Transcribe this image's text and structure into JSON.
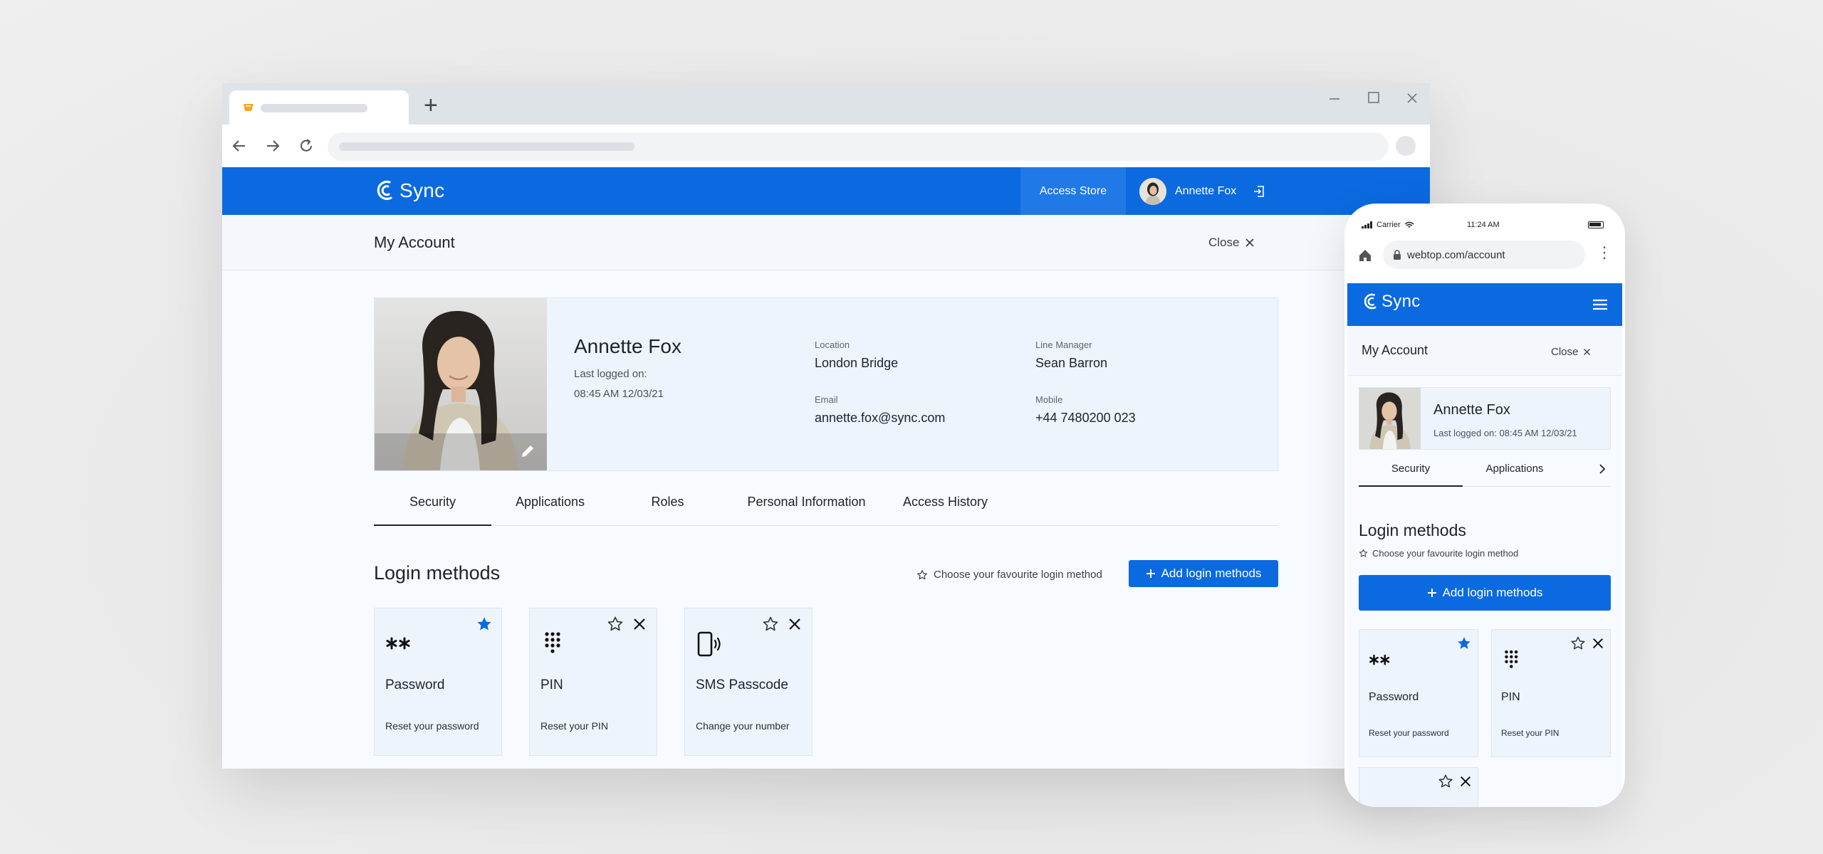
{
  "colors": {
    "brand": "#0b6ae0",
    "brand_hover": "#2079e6",
    "star_active": "#0b6ae0"
  },
  "desktop": {
    "header": {
      "logo_text": "Sync",
      "access_store_label": "Access Store",
      "user_name": "Annette Fox"
    },
    "subbar": {
      "title": "My Account",
      "close_label": "Close"
    },
    "profile": {
      "name": "Annette Fox",
      "last_logged_label": "Last logged on:",
      "last_logged_value": "08:45 AM 12/03/21",
      "location_label": "Location",
      "location_value": "London Bridge",
      "manager_label": "Line Manager",
      "manager_value": "Sean Barron",
      "email_label": "Email",
      "email_value": "annette.fox@sync.com",
      "mobile_label": "Mobile",
      "mobile_value": "+44 7480200 023"
    },
    "tabs": [
      "Security",
      "Applications",
      "Roles",
      "Personal Information",
      "Access History"
    ],
    "active_tab": "Security",
    "login_methods": {
      "title": "Login methods",
      "hint": "Choose your favourite login method",
      "add_label": "Add login methods",
      "cards": [
        {
          "name": "Password",
          "action": "Reset your password",
          "icon": "asterisk-icon",
          "favourite": true
        },
        {
          "name": "PIN",
          "action": "Reset your PIN",
          "icon": "keypad-icon",
          "favourite": false
        },
        {
          "name": "SMS Passcode",
          "action": "Change your number",
          "icon": "phone-signal-icon",
          "favourite": false
        }
      ]
    }
  },
  "mobile": {
    "status": {
      "carrier": "Carrier",
      "time": "11:24 AM"
    },
    "url": "webtop.com/account",
    "header": {
      "logo_text": "Sync"
    },
    "subbar": {
      "title": "My Account",
      "close_label": "Close"
    },
    "profile": {
      "name": "Annette Fox",
      "last_logged": "Last logged on: 08:45 AM 12/03/21"
    },
    "tabs": [
      "Security",
      "Applications"
    ],
    "login_methods": {
      "title": "Login methods",
      "hint": "Choose your favourite login method",
      "add_label": "Add login methods",
      "cards": [
        {
          "name": "Password",
          "action": "Reset your password",
          "favourite": true
        },
        {
          "name": "PIN",
          "action": "Reset your PIN",
          "favourite": false
        }
      ]
    }
  }
}
